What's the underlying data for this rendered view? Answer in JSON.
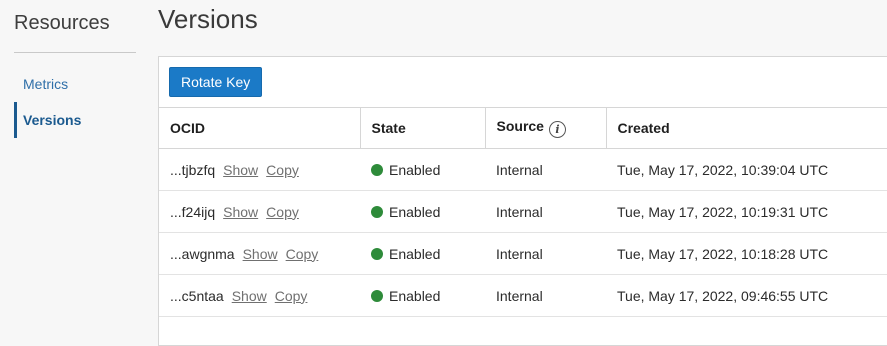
{
  "sidebar": {
    "title": "Resources",
    "items": [
      {
        "label": "Metrics",
        "active": false
      },
      {
        "label": "Versions",
        "active": true
      }
    ]
  },
  "page": {
    "title": "Versions"
  },
  "toolbar": {
    "rotate_label": "Rotate Key"
  },
  "table": {
    "headers": {
      "ocid": "OCID",
      "state": "State",
      "source": "Source",
      "source_info_icon": "i",
      "created": "Created"
    },
    "rows": [
      {
        "ocid": "...tjbzfq",
        "show": "Show",
        "copy": "Copy",
        "state": "Enabled",
        "source": "Internal",
        "created": "Tue, May 17, 2022, 10:39:04 UTC"
      },
      {
        "ocid": "...f24ijq",
        "show": "Show",
        "copy": "Copy",
        "state": "Enabled",
        "source": "Internal",
        "created": "Tue, May 17, 2022, 10:19:31 UTC"
      },
      {
        "ocid": "...awgnma",
        "show": "Show",
        "copy": "Copy",
        "state": "Enabled",
        "source": "Internal",
        "created": "Tue, May 17, 2022, 10:18:28 UTC"
      },
      {
        "ocid": "...c5ntaa",
        "show": "Show",
        "copy": "Copy",
        "state": "Enabled",
        "source": "Internal",
        "created": "Tue, May 17, 2022, 09:46:55 UTC"
      }
    ]
  },
  "colors": {
    "accent": "#1b7ac7",
    "enabled_status": "#2e8b3a",
    "link": "#2f6fa8"
  },
  "icons": {
    "status": "status-dot-icon",
    "info": "info-icon"
  }
}
